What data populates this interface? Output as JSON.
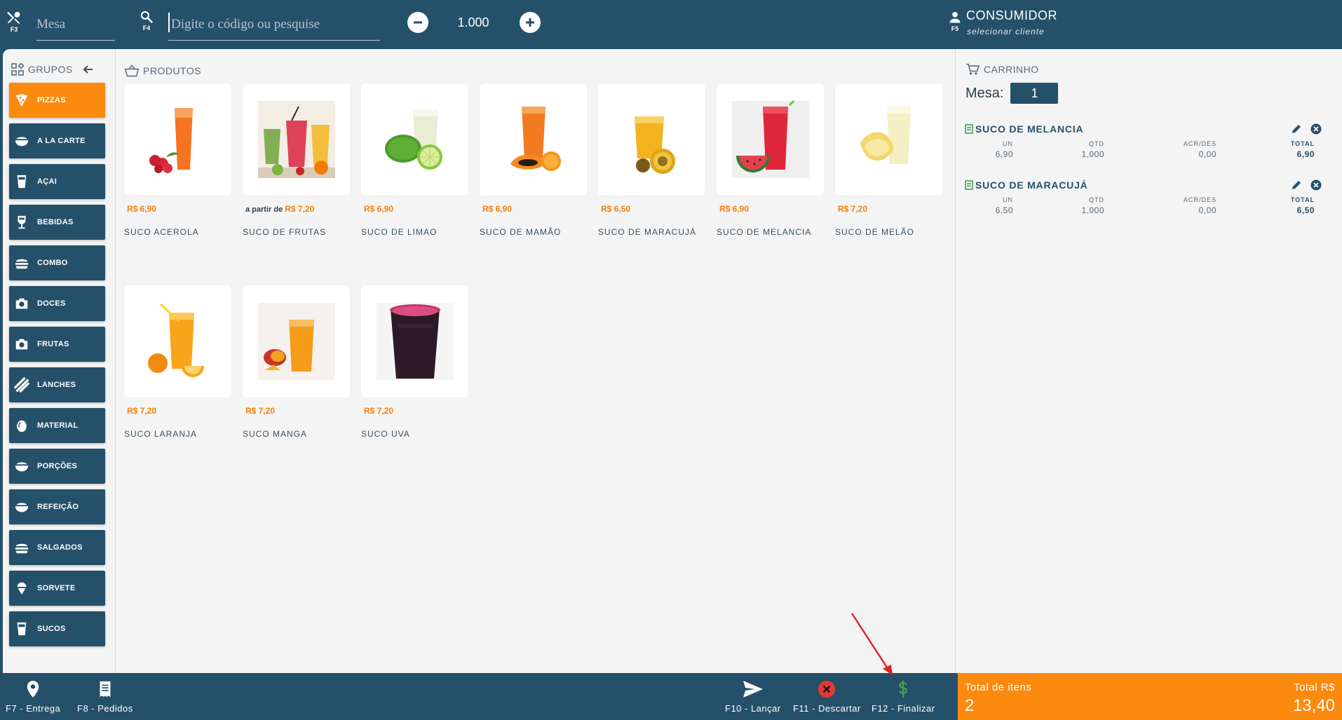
{
  "topbar": {
    "mesa_key": "F3",
    "mesa_placeholder": "Mesa",
    "search_key": "F4",
    "search_placeholder": "Digite o código ou pesquise",
    "quantity": "1.000",
    "customer_key": "F5",
    "customer_name": "CONSUMIDOR",
    "customer_sub": "selecionar cliente"
  },
  "groups": {
    "title": "GRUPOS",
    "items": [
      {
        "label": "PIZZAS",
        "icon": "pizza-icon"
      },
      {
        "label": "A LA CARTE",
        "icon": "bowl-icon"
      },
      {
        "label": "AÇAI",
        "icon": "cup-icon"
      },
      {
        "label": "BEBIDAS",
        "icon": "wine-icon"
      },
      {
        "label": "COMBO",
        "icon": "burger-icon"
      },
      {
        "label": "DOCES",
        "icon": "camera-icon"
      },
      {
        "label": "FRUTAS",
        "icon": "camera-icon"
      },
      {
        "label": "LANCHES",
        "icon": "stripes-icon"
      },
      {
        "label": "MATERIAL",
        "icon": "egg-icon"
      },
      {
        "label": "PORÇÕES",
        "icon": "bowl-icon"
      },
      {
        "label": "REFEIÇÃO",
        "icon": "bowl-icon"
      },
      {
        "label": "SALGADOS",
        "icon": "burger-icon"
      },
      {
        "label": "SORVETE",
        "icon": "icecream-icon"
      },
      {
        "label": "SUCOS",
        "icon": "cup-icon"
      }
    ]
  },
  "products": {
    "title": "PRODUTOS",
    "items": [
      {
        "prefix": "",
        "price": "R$ 6,90",
        "name": "SUCO ACEROLA"
      },
      {
        "prefix": "a partir de ",
        "price": "R$ 7,20",
        "name": "SUCO DE FRUTAS"
      },
      {
        "prefix": "",
        "price": "R$ 6,90",
        "name": "SUCO DE LIMAO"
      },
      {
        "prefix": "",
        "price": "R$ 6,90",
        "name": "SUCO DE MAMÃO"
      },
      {
        "prefix": "",
        "price": "R$ 6,50",
        "name": "SUCO DE MARACUJÁ"
      },
      {
        "prefix": "",
        "price": "R$ 6,90",
        "name": "SUCO DE MELANCIA"
      },
      {
        "prefix": "",
        "price": "R$ 7,20",
        "name": "SUCO DE MELÃO"
      },
      {
        "prefix": "",
        "price": "R$ 7,20",
        "name": "SUCO LARANJA"
      },
      {
        "prefix": "",
        "price": "R$ 7,20",
        "name": "SUCO MANGA"
      },
      {
        "prefix": "",
        "price": "R$ 7,20",
        "name": "SUCO UVA"
      }
    ]
  },
  "cart": {
    "title": "CARRINHO",
    "mesa_label": "Mesa:",
    "mesa_value": "1",
    "headers": {
      "un": "UN",
      "qtd": "QTD",
      "acr": "ACR/DES",
      "total": "TOTAL"
    },
    "items": [
      {
        "name": "SUCO DE MELANCIA",
        "un": "6,90",
        "qtd": "1,000",
        "acr": "0,00",
        "total": "6,90"
      },
      {
        "name": "SUCO DE MARACUJÁ",
        "un": "6,50",
        "qtd": "1,000",
        "acr": "0,00",
        "total": "6,50"
      }
    ]
  },
  "bottombar": {
    "entrega": "F7 - Entrega",
    "pedidos": "F8 - Pedidos",
    "lancar": "F10 - Lançar",
    "descartar": "F11 - Descartar",
    "finalizar": "F12 - Finalizar"
  },
  "totals": {
    "items_label": "Total de itens",
    "items_value": "2",
    "total_label": "Total R$",
    "total_value": "13,40"
  },
  "colors": {
    "primary": "#25506a",
    "accent": "#fb8a0f",
    "price": "#f57f0a",
    "finalize": "#3aa64c",
    "discard": "#e53935"
  }
}
